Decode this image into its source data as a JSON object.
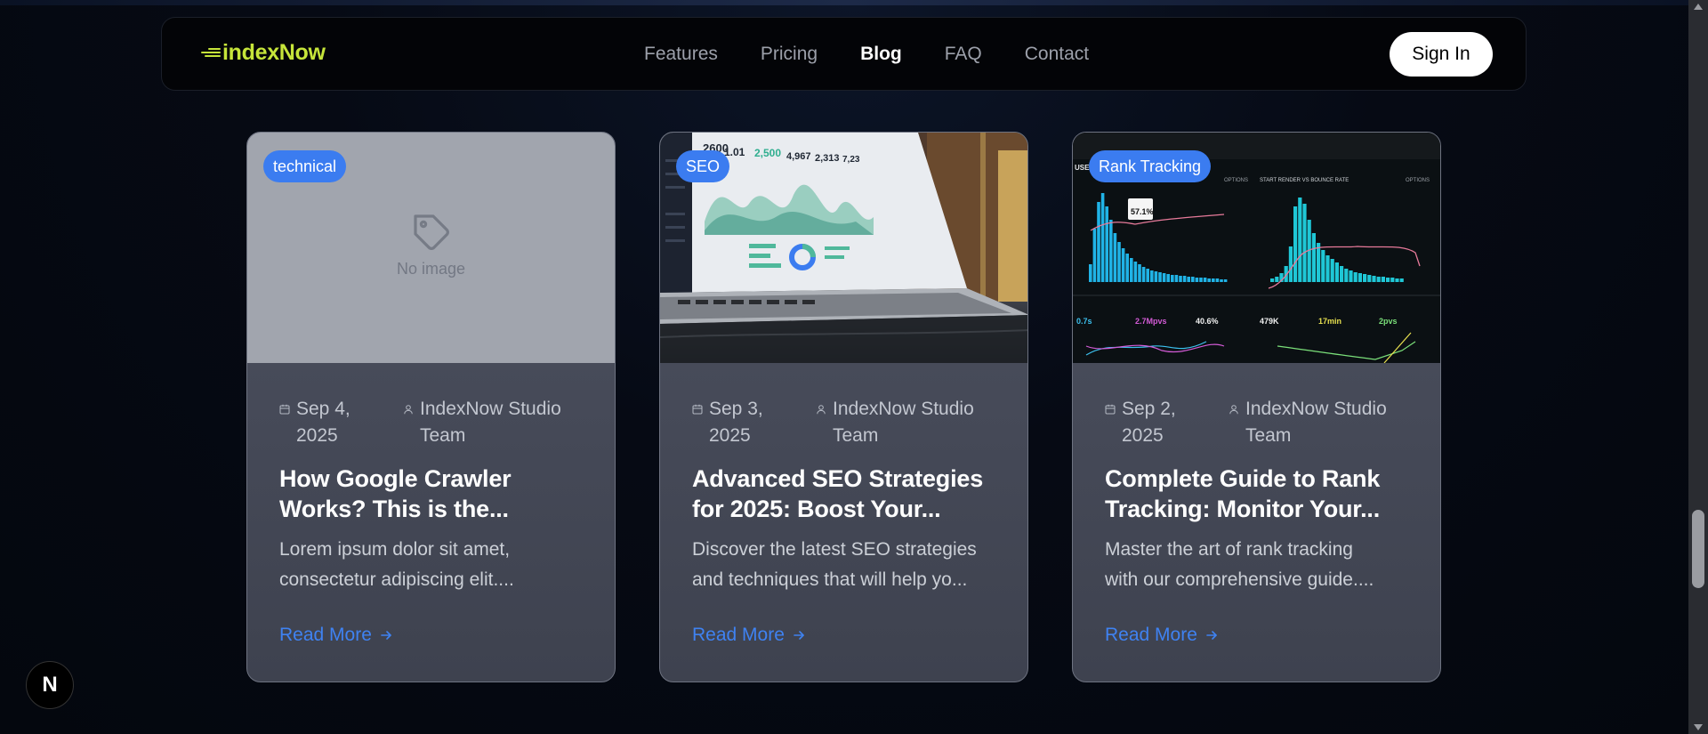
{
  "nav": {
    "logo": "indexNow",
    "links": [
      {
        "label": "Features",
        "active": false
      },
      {
        "label": "Pricing",
        "active": false
      },
      {
        "label": "Blog",
        "active": true
      },
      {
        "label": "FAQ",
        "active": false
      },
      {
        "label": "Contact",
        "active": false
      }
    ],
    "signin_label": "Sign In"
  },
  "cards": [
    {
      "badge": "technical",
      "image": "placeholder",
      "placeholder_text": "No image",
      "date": "Sep 4, 2025",
      "author": "IndexNow Studio Team",
      "title": "How Google Crawler\nWorks? This is the...",
      "excerpt": "Lorem ipsum dolor sit amet,\nconsectetur adipiscing elit....",
      "read_more": "Read More"
    },
    {
      "badge": "SEO",
      "image": "laptop-analytics-photo",
      "date": "Sep 3, 2025",
      "author": "IndexNow Studio Team",
      "title": "Advanced SEO Strategies\nfor 2025: Boost Your...",
      "excerpt": "Discover the latest SEO strategies\nand techniques that will help yo...",
      "read_more": "Read More"
    },
    {
      "badge": "Rank Tracking",
      "image": "analytics-dashboard-photo",
      "date": "Sep 2, 2025",
      "author": "IndexNow Studio Team",
      "title": "Complete Guide to Rank\nTracking: Monitor Your...",
      "excerpt": "Master the art of rank tracking\nwith our comprehensive guide....",
      "read_more": "Read More",
      "dashboard": {
        "headers": [
          "USE",
          "OPTIONS",
          "START RENDER VS BOUNCE RATE",
          "OPTIONS"
        ],
        "tooltip": "57.1%",
        "stats": [
          "0.7s",
          "2.7Mpvs",
          "40.6%",
          "479K",
          "17min",
          "2pvs"
        ]
      }
    }
  ],
  "next_badge": "N",
  "colors": {
    "accent": "#c6e53a",
    "badge": "#3b7cf0",
    "link": "#3f82f1"
  }
}
